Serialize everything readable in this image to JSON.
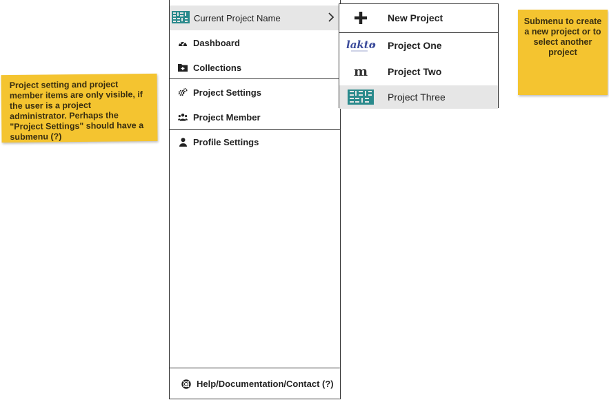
{
  "notes": {
    "left": "Project setting and project member items are only visible, if the user is a project administrator. Perhaps the \"Project Settings\" should have a submenu (?)",
    "right": "Submenu to create a new project or to select another project"
  },
  "sidebar": {
    "current_project": "Current Project Name",
    "items": [
      {
        "label": "Dashboard",
        "icon": "gauge-icon"
      },
      {
        "label": "Collections",
        "icon": "folder-plus-icon"
      },
      {
        "label": "Project Settings",
        "icon": "gears-icon"
      },
      {
        "label": "Project Member",
        "icon": "users-icon"
      },
      {
        "label": "Profile Settings",
        "icon": "user-icon"
      }
    ],
    "help": "Help/Documentation/Contact (?)"
  },
  "submenu": {
    "new_project": "New Project",
    "projects": [
      {
        "label": "Project One",
        "logo": "lakto-logo"
      },
      {
        "label": "Project Two",
        "logo": "m-logo"
      },
      {
        "label": "Project Three",
        "logo": "grid-logo"
      }
    ]
  },
  "colors": {
    "accent_teal": "#2a8a8c",
    "sticky_yellow": "#f4c430",
    "selected_bg": "#e6e6e6"
  }
}
